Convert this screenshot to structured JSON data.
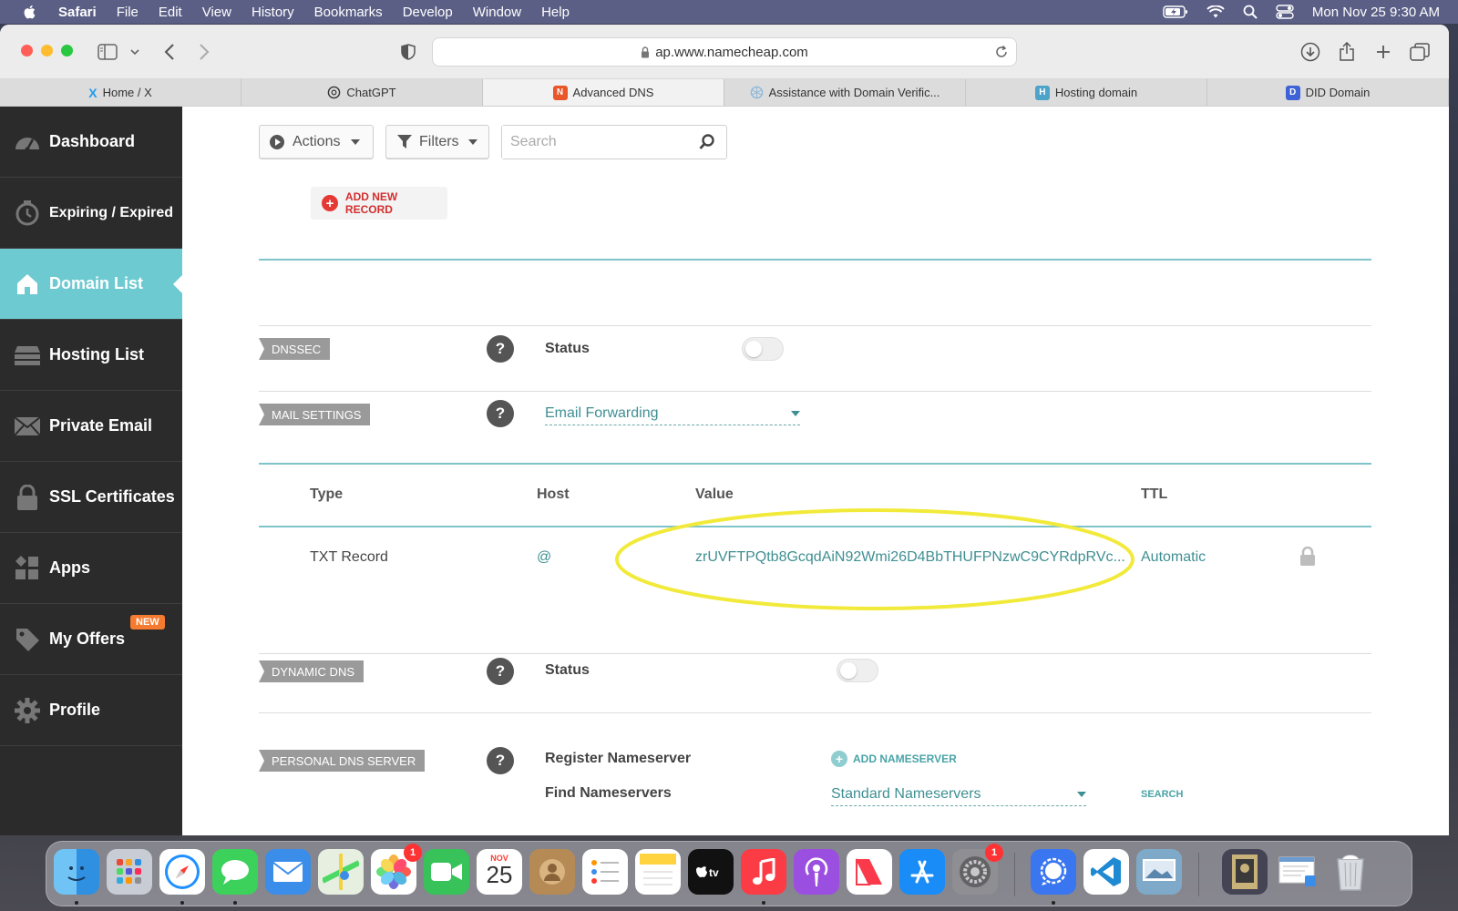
{
  "menubar": {
    "app_name": "Safari",
    "items": [
      "File",
      "Edit",
      "View",
      "History",
      "Bookmarks",
      "Develop",
      "Window",
      "Help"
    ],
    "clock": "Mon Nov 25  9:30 AM"
  },
  "browser": {
    "url": "ap.www.namecheap.com",
    "tabs": [
      {
        "label": "Home / X",
        "icon": "x-icon"
      },
      {
        "label": "ChatGPT",
        "icon": "chatgpt-icon"
      },
      {
        "label": "Advanced DNS",
        "icon": "namecheap-icon",
        "active": true
      },
      {
        "label": "Assistance with Domain Verific...",
        "icon": "openai-icon"
      },
      {
        "label": "Hosting domain",
        "icon": "hosting-icon"
      },
      {
        "label": "DID Domain",
        "icon": "did-icon"
      }
    ]
  },
  "sidebar": {
    "items": [
      {
        "label": "Dashboard",
        "icon": "gauge-icon"
      },
      {
        "label": "Expiring / Expired",
        "icon": "timer-icon"
      },
      {
        "label": "Domain List",
        "icon": "home-icon",
        "active": true
      },
      {
        "label": "Hosting List",
        "icon": "server-icon"
      },
      {
        "label": "Private Email",
        "icon": "envelope-icon"
      },
      {
        "label": "SSL Certificates",
        "icon": "lock-icon"
      },
      {
        "label": "Apps",
        "icon": "apps-icon"
      },
      {
        "label": "My Offers",
        "icon": "tag-icon",
        "badge": "NEW"
      },
      {
        "label": "Profile",
        "icon": "gear-icon"
      }
    ]
  },
  "toolbar": {
    "actions_label": "Actions",
    "filters_label": "Filters",
    "search_placeholder": "Search",
    "add_record_label": "ADD NEW RECORD"
  },
  "dnssec": {
    "section_label": "DNSSEC",
    "status_label": "Status",
    "enabled": false
  },
  "mail": {
    "section_label": "MAIL SETTINGS",
    "selected": "Email Forwarding"
  },
  "records": {
    "headers": {
      "type": "Type",
      "host": "Host",
      "value": "Value",
      "ttl": "TTL"
    },
    "rows": [
      {
        "type": "TXT Record",
        "host": "@",
        "value": "zrUVFTPQtb8GcqdAiN92Wmi26D4BbTHUFPNzwC9CYRdpRVc...",
        "ttl": "Automatic",
        "locked": true
      }
    ]
  },
  "dynamic_dns": {
    "section_label": "DYNAMIC DNS",
    "status_label": "Status",
    "enabled": false
  },
  "personal_dns": {
    "section_label": "PERSONAL DNS SERVER",
    "register_label": "Register Nameserver",
    "add_nameserver_label": "ADD NAMESERVER",
    "find_label": "Find Nameservers",
    "find_selected": "Standard Nameservers",
    "search_label": "SEARCH"
  },
  "dock": {
    "calendar_month": "NOV",
    "calendar_day": "25",
    "photos_badge": "1",
    "settings_badge": "1"
  },
  "colors": {
    "sidebar_bg": "#2b2b2b",
    "sidebar_active": "#6ecad1",
    "teal_text": "#3f8f92",
    "highlight": "#f2ea3a"
  }
}
